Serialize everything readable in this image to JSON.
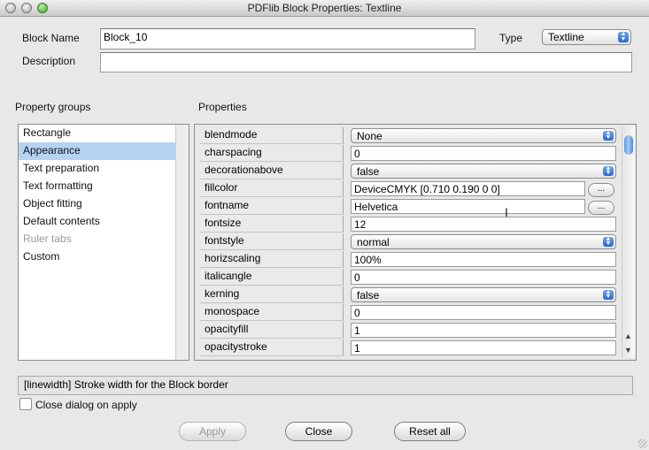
{
  "window": {
    "title": "PDFlib Block Properties: Textline"
  },
  "header": {
    "block_name_label": "Block Name",
    "block_name_value": "Block_10",
    "type_label": "Type",
    "type_value": "Textline",
    "description_label": "Description",
    "description_value": ""
  },
  "groups": {
    "heading": "Property groups",
    "items": [
      {
        "label": "Rectangle"
      },
      {
        "label": "Appearance"
      },
      {
        "label": "Text preparation"
      },
      {
        "label": "Text formatting"
      },
      {
        "label": "Object fitting"
      },
      {
        "label": "Default contents"
      },
      {
        "label": "Ruler tabs"
      },
      {
        "label": "Custom"
      }
    ],
    "selected": "Appearance",
    "disabled": [
      "Ruler tabs"
    ]
  },
  "properties": {
    "heading": "Properties",
    "rows": [
      {
        "name": "blendmode",
        "value": "None",
        "kind": "select"
      },
      {
        "name": "charspacing",
        "value": "0",
        "kind": "text"
      },
      {
        "name": "decorationabove",
        "value": "false",
        "kind": "select"
      },
      {
        "name": "fillcolor",
        "value": "DeviceCMYK [0.710 0.190 0 0]",
        "kind": "text-button"
      },
      {
        "name": "fontname",
        "value": "Helvetica",
        "kind": "text-button"
      },
      {
        "name": "fontsize",
        "value": "12",
        "kind": "text"
      },
      {
        "name": "fontstyle",
        "value": "normal",
        "kind": "select"
      },
      {
        "name": "horizscaling",
        "value": "100%",
        "kind": "text"
      },
      {
        "name": "italicangle",
        "value": "0",
        "kind": "text"
      },
      {
        "name": "kerning",
        "value": "false",
        "kind": "select"
      },
      {
        "name": "monospace",
        "value": "0",
        "kind": "text"
      },
      {
        "name": "opacityfill",
        "value": "1",
        "kind": "text"
      },
      {
        "name": "opacitystroke",
        "value": "1",
        "kind": "text"
      }
    ],
    "ellipsis_label": "..."
  },
  "status": {
    "text": "[linewidth] Stroke width for the Block border"
  },
  "close_on_apply": {
    "label": "Close dialog on apply",
    "checked": false
  },
  "buttons": {
    "apply": "Apply",
    "close": "Close",
    "reset": "Reset all"
  },
  "icons": {
    "popup_arrows": "up-down-arrows-icon",
    "text_cursor": "i-beam-cursor-icon"
  }
}
